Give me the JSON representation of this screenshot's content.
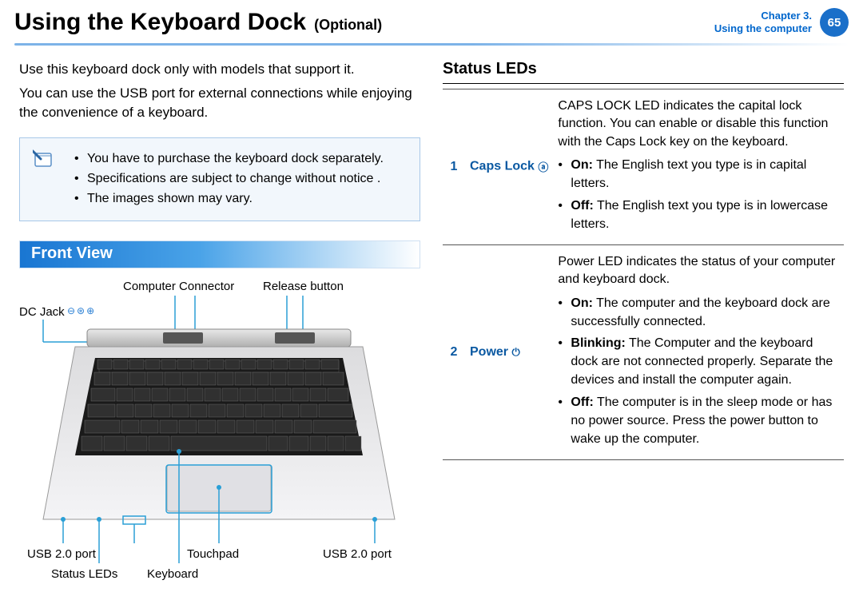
{
  "header": {
    "title": "Using the Keyboard Dock",
    "tag": "(Optional)",
    "chapter_line1": "Chapter 3.",
    "chapter_line2": "Using the computer",
    "page": "65"
  },
  "intro": {
    "p1": "Use this keyboard dock only with models that support it.",
    "p2": "You can use the USB port for external connections while enjoying the convenience of a keyboard."
  },
  "note": {
    "items": [
      "You have to purchase the keyboard dock separately.",
      "Specifications are subject to change without notice .",
      "The images shown may vary."
    ]
  },
  "front_view": {
    "heading": "Front View",
    "callouts": {
      "computer_connector": "Computer Connector",
      "release_button": "Release button",
      "dc_jack": "DC Jack",
      "usb_left": "USB 2.0 port",
      "status_leds": "Status LEDs",
      "keyboard": "Keyboard",
      "touchpad": "Touchpad",
      "usb_right": "USB 2.0 port"
    }
  },
  "status_leds": {
    "heading": "Status LEDs",
    "rows": [
      {
        "num": "1",
        "label": "Caps Lock",
        "icon": "ⓐ",
        "desc_intro": "CAPS LOCK LED indicates the capital lock function. You can enable or disable this function with the Caps Lock key on the keyboard.",
        "bullets": [
          {
            "lead": "On:",
            "text": " The English text you type is in capital letters."
          },
          {
            "lead": "Off:",
            "text": " The English text you type is in lowercase letters."
          }
        ]
      },
      {
        "num": "2",
        "label": "Power",
        "icon": "⏻",
        "desc_intro": "Power LED indicates the status of your computer and keyboard dock.",
        "bullets": [
          {
            "lead": "On:",
            "text": " The computer and the keyboard dock are successfully connected."
          },
          {
            "lead": "Blinking:",
            "text": " The Computer and the keyboard dock are not connected properly. Separate the devices and install the computer again."
          },
          {
            "lead": "Off:",
            "text": " The computer is in the sleep mode or has no power source. Press the power button to wake up the computer."
          }
        ]
      }
    ]
  }
}
